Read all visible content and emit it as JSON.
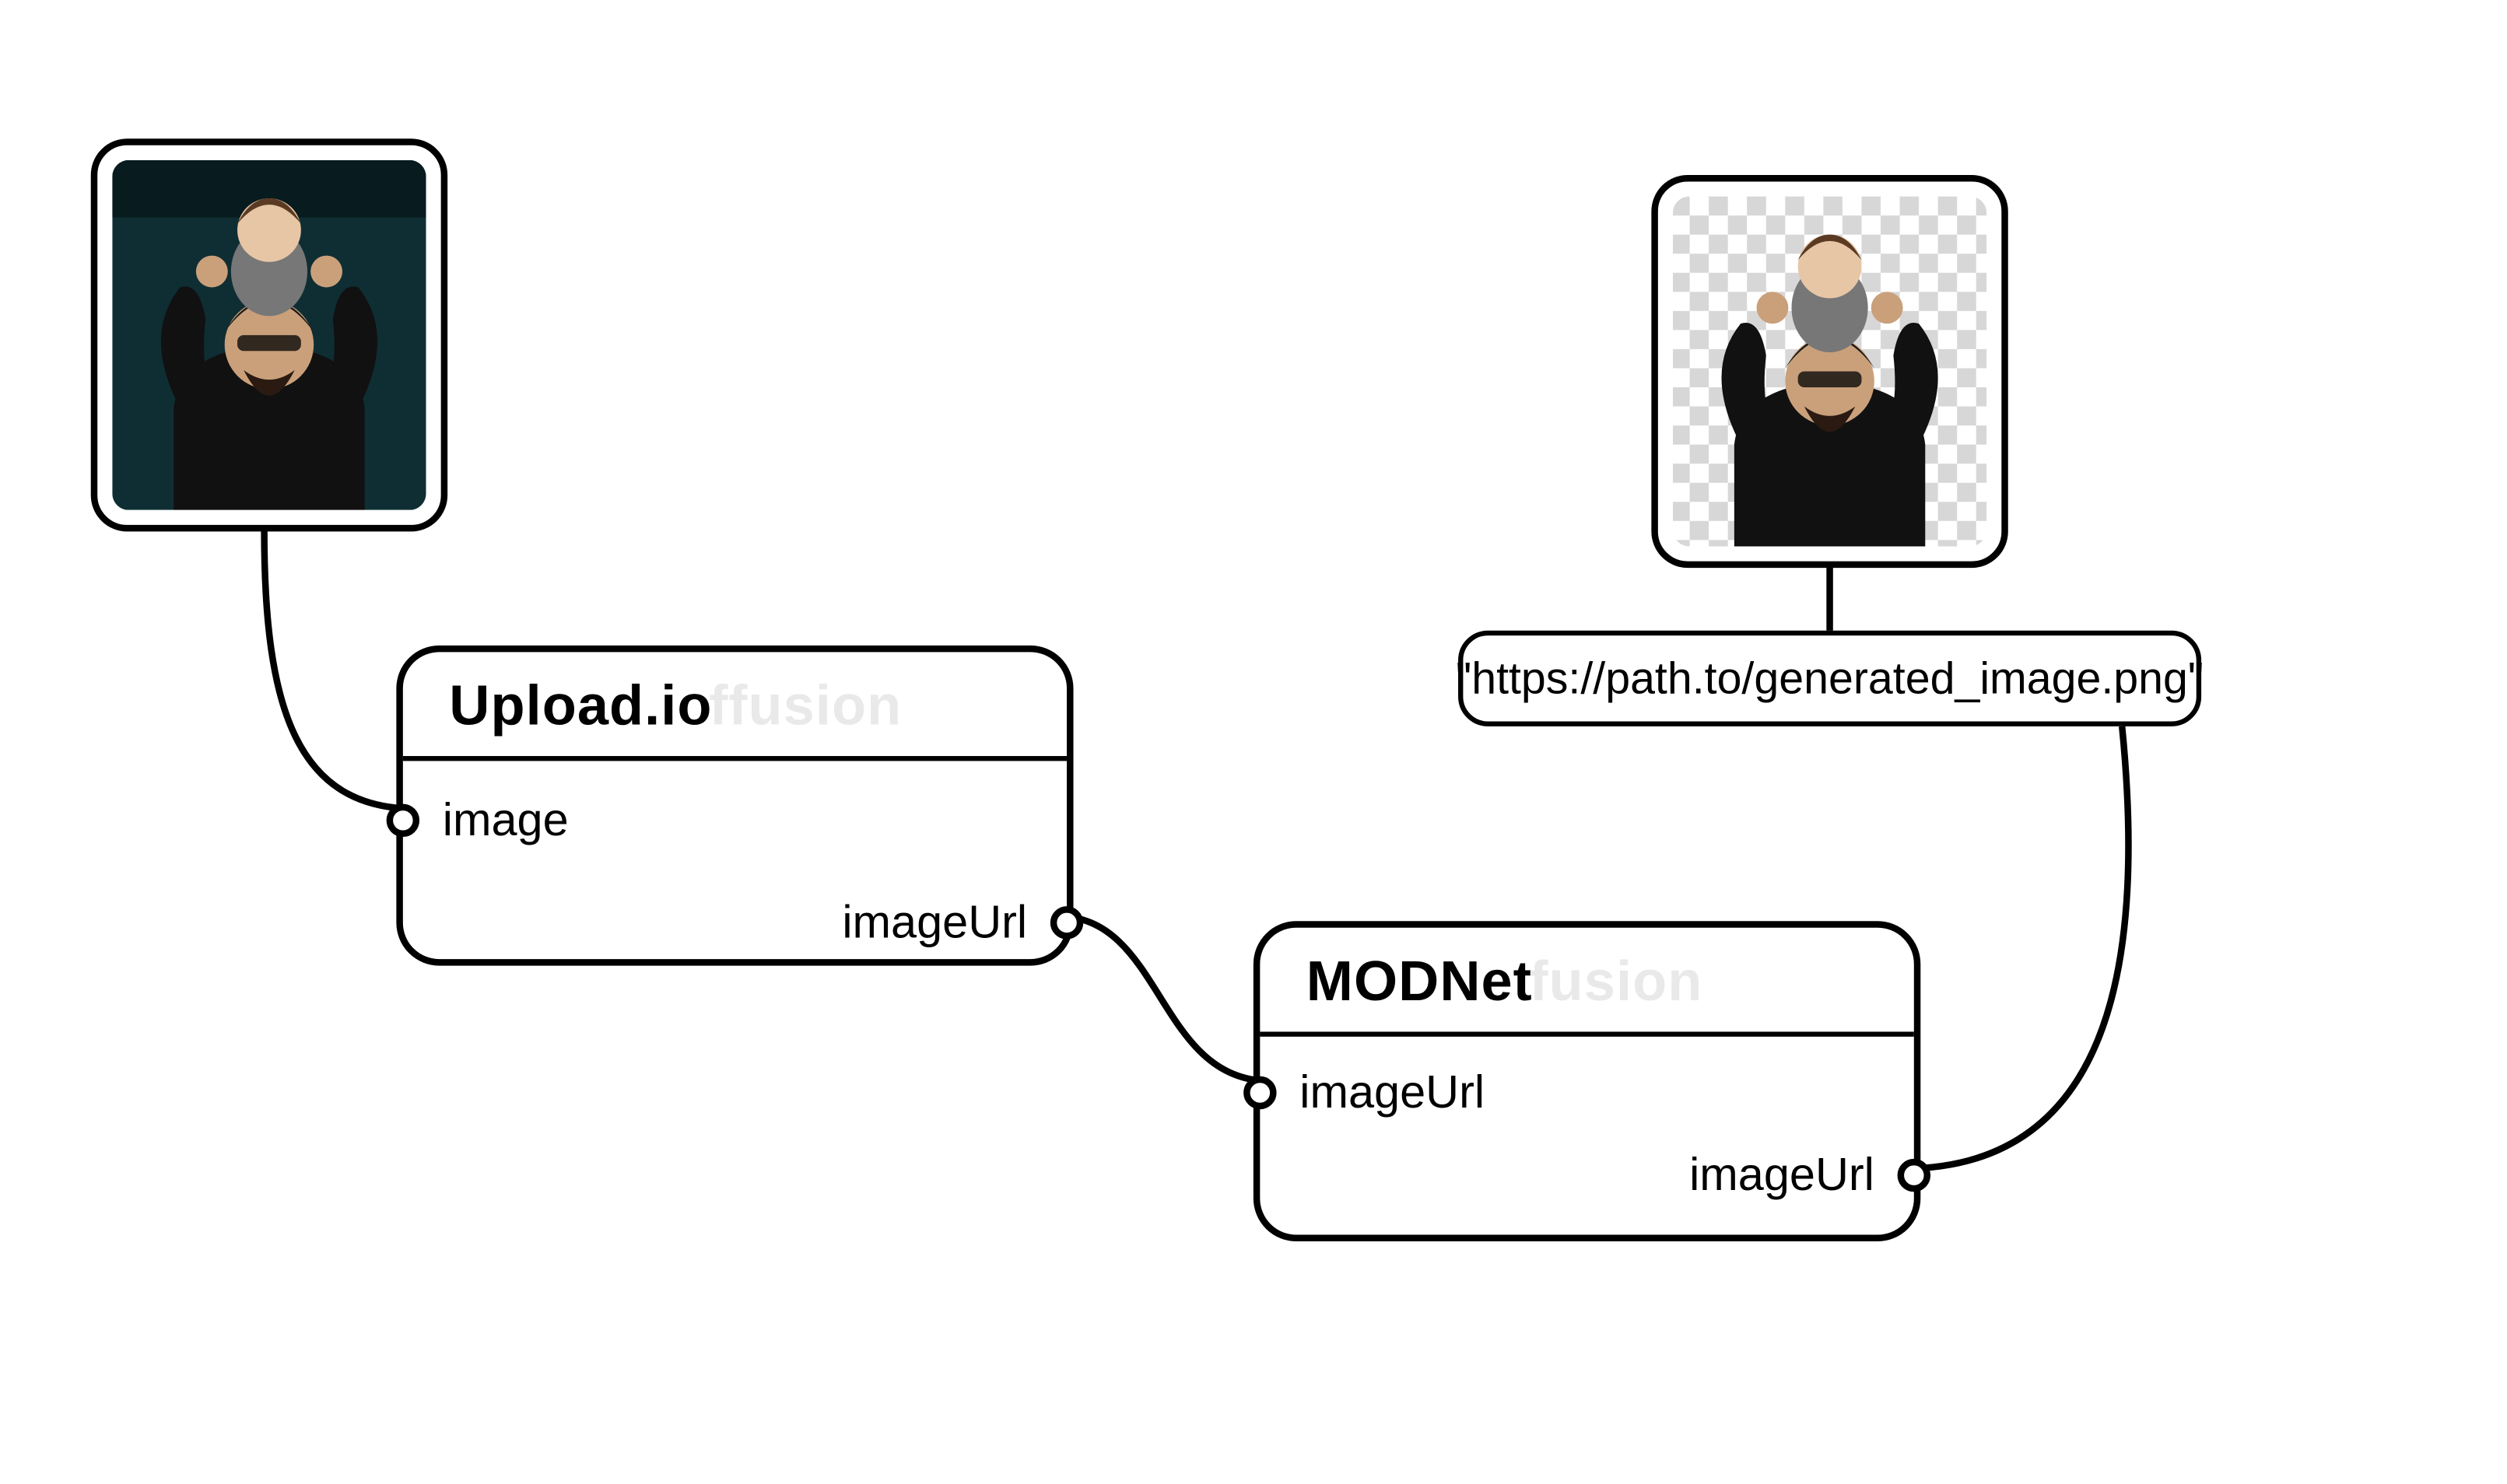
{
  "nodes": {
    "upload": {
      "title": "Upload.io",
      "ghost": "ffusion",
      "input_port": "image",
      "output_port": "imageUrl"
    },
    "modnet": {
      "title": "MODNet",
      "ghost": "fusion",
      "input_port": "imageUrl",
      "output_port": "imageUrl"
    }
  },
  "output_url": "\"https://path.to/generated_image.png\""
}
